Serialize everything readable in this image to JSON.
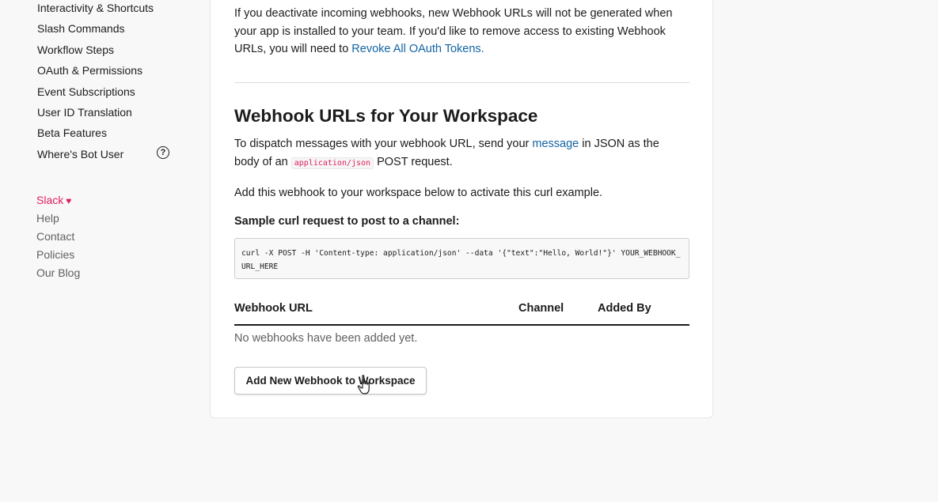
{
  "sidebar": {
    "items": [
      {
        "label": "Interactivity & Shortcuts"
      },
      {
        "label": "Slash Commands"
      },
      {
        "label": "Workflow Steps"
      },
      {
        "label": "OAuth & Permissions"
      },
      {
        "label": "Event Subscriptions"
      },
      {
        "label": "User ID Translation"
      },
      {
        "label": "Beta Features"
      },
      {
        "label": "Where's Bot User",
        "icon": "help-circle-icon"
      }
    ],
    "help_icon_glyph": "?"
  },
  "footer": {
    "slack_label": "Slack",
    "heart_glyph": "♥",
    "links": [
      "Help",
      "Contact",
      "Policies",
      "Our Blog"
    ]
  },
  "main": {
    "intro_text": "If you deactivate incoming webhooks, new Webhook URLs will not be generated when your app is installed to your team. If you'd like to remove access to existing Webhook URLs, you will need to ",
    "revoke_link": "Revoke All OAuth Tokens.",
    "section_title": "Webhook URLs for Your Workspace",
    "dispatch_text_1": "To dispatch messages with your webhook URL, send your ",
    "dispatch_link": "message",
    "dispatch_text_2": " in JSON as the body of an ",
    "dispatch_code": "application/json",
    "dispatch_text_3": " POST request.",
    "add_this_text": "Add this webhook to your workspace below to activate this curl example.",
    "sample_label": "Sample curl request to post to a channel:",
    "curl_example": "curl -X POST -H 'Content-type: application/json' --data '{\"text\":\"Hello, World!\"}' YOUR_WEBHOOK_URL_HERE",
    "table": {
      "columns": [
        "Webhook URL",
        "Channel",
        "Added By"
      ],
      "empty_message": "No webhooks have been added yet."
    },
    "add_button_label": "Add New Webhook to Workspace"
  },
  "colors": {
    "link": "#1264a3",
    "slack_accent": "#e01e5a",
    "text": "#1d1c1d",
    "muted": "#616061"
  }
}
